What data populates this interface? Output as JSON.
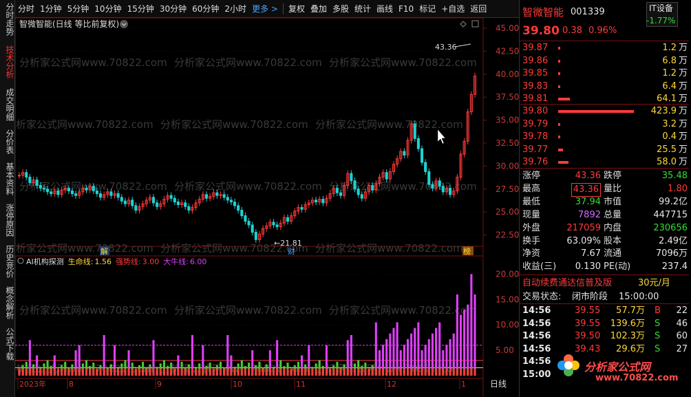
{
  "toolbar": {
    "items": [
      "分时",
      "1分钟",
      "5分钟",
      "10分钟",
      "15分钟",
      "30分钟",
      "60分钟",
      "2小时"
    ],
    "more": "更多 >",
    "right_items": [
      "复权",
      "叠加",
      "多股",
      "统计",
      "画线",
      "F10",
      "标记",
      "+自选",
      "返回"
    ]
  },
  "sidebar": {
    "items": [
      "分时走势",
      "技术分析",
      "成交明细",
      "分价表",
      "基本资料",
      "涨停原因",
      "历史竞价",
      "概念解析",
      "公式下载"
    ]
  },
  "chart": {
    "title": "智微智能(日线 等比前复权)",
    "y_ticks": [
      "45.00",
      "42.50",
      "40.00",
      "37.50",
      "35.00",
      "32.50",
      "30.00",
      "27.50",
      "25.00",
      "22.50"
    ],
    "max_label": "43.36",
    "min_label": "21.81",
    "markers": {
      "jie": "解",
      "cai": "财",
      "bang": "榜"
    },
    "watermark": "分析家公式网www.70822.com",
    "indicator": {
      "title": "AI机构探测",
      "line1_label": "生命线:",
      "line1_value": "1.56",
      "line2_label": "强势线:",
      "line2_value": "3.00",
      "line3_label": "大牛线:",
      "line3_value": "6.00",
      "y_ticks": [
        "20.00",
        "15.00",
        "10.00",
        "5.00"
      ]
    },
    "x_labels": [
      "2023年",
      "8",
      "9",
      "10",
      "11",
      "12",
      "1"
    ],
    "period_label": "日线"
  },
  "quote": {
    "name": "智微智能",
    "code": "001339",
    "sector": "IT设备",
    "sector_pct": "-1.77%",
    "price": "39.80",
    "change": "0.38",
    "change_pct": "0.96%",
    "asks": [
      {
        "price": "39.87",
        "vol": "1.2",
        "unit": "万",
        "bar": 0.003
      },
      {
        "price": "39.86",
        "vol": "6.8",
        "unit": "万",
        "bar": 0.016
      },
      {
        "price": "39.85",
        "vol": "1.2",
        "unit": "万",
        "bar": 0.003
      },
      {
        "price": "39.83",
        "vol": "6.4",
        "unit": "万",
        "bar": 0.015
      },
      {
        "price": "39.81",
        "vol": "64.1",
        "unit": "万",
        "bar": 0.151
      }
    ],
    "bids": [
      {
        "price": "39.80",
        "vol": "423.9",
        "unit": "万",
        "bar": 1.0
      },
      {
        "price": "39.79",
        "vol": "3.2",
        "unit": "万",
        "bar": 0.008
      },
      {
        "price": "39.78",
        "vol": "0.4",
        "unit": "万",
        "bar": 0.001
      },
      {
        "price": "39.77",
        "vol": "25.5",
        "unit": "万",
        "bar": 0.06
      },
      {
        "price": "39.76",
        "vol": "58.0",
        "unit": "万",
        "bar": 0.137
      }
    ],
    "stats": [
      {
        "l1": "涨停",
        "v1": "43.36",
        "c1": "red",
        "l2": "跌停",
        "v2": "35.48",
        "c2": "green"
      },
      {
        "l1": "最高",
        "v1": "43.36",
        "c1": "red",
        "box1": true,
        "l2": "量比",
        "v2": "1.80",
        "c2": "red"
      },
      {
        "l1": "最低",
        "v1": "37.94",
        "c1": "green",
        "l2": "市值",
        "v2": "99.2亿",
        "c2": "white"
      },
      {
        "l1": "现量",
        "v1": "7892",
        "c1": "purple",
        "l2": "总量",
        "v2": "447715",
        "c2": "white"
      },
      {
        "l1": "外盘",
        "v1": "217059",
        "c1": "red",
        "l2": "内盘",
        "v2": "230656",
        "c2": "green"
      },
      {
        "l1": "换手",
        "v1": "63.09%",
        "c1": "white",
        "l2": "股本",
        "v2": "2.49亿",
        "c2": "white"
      },
      {
        "l1": "净资",
        "v1": "7.67",
        "c1": "white",
        "l2": "流通",
        "v2": "7096万",
        "c2": "white"
      },
      {
        "l1": "收益(三)",
        "v1": "0.130",
        "c1": "white",
        "l2": "PE(动)",
        "v2": "237.4",
        "c2": "white"
      }
    ],
    "promo": "自动续费通达信普及版",
    "promo_price": "30元/月",
    "trade_state_label": "交易状态:",
    "trade_state": "闭市阶段",
    "trade_time": "15:00:00",
    "ticks": [
      {
        "t": "14:56",
        "p": "39.55",
        "v": "57.7万",
        "s": "B",
        "n": "22"
      },
      {
        "t": "14:56",
        "p": "39.55",
        "v": "139.6万",
        "s": "S",
        "n": "46"
      },
      {
        "t": "14:56",
        "p": "39.50",
        "v": "102.3万",
        "s": "S",
        "n": "60"
      },
      {
        "t": "14:56",
        "p": "39.43",
        "v": "29.6万",
        "s": "S",
        "n": "27"
      },
      {
        "t": "14:56",
        "p": "",
        "v": "",
        "s": "",
        "n": ""
      },
      {
        "t": "15:00",
        "p": "",
        "v": "",
        "s": "",
        "n": ""
      }
    ],
    "logo_text": "分析家公式网",
    "logo_url": "www.70822.com"
  },
  "colors": {
    "up": "#ff3b3b",
    "down": "#1fd2d2",
    "bg": "#000000",
    "magenta": "#e040fb",
    "vol_green": "#44cc33"
  }
}
